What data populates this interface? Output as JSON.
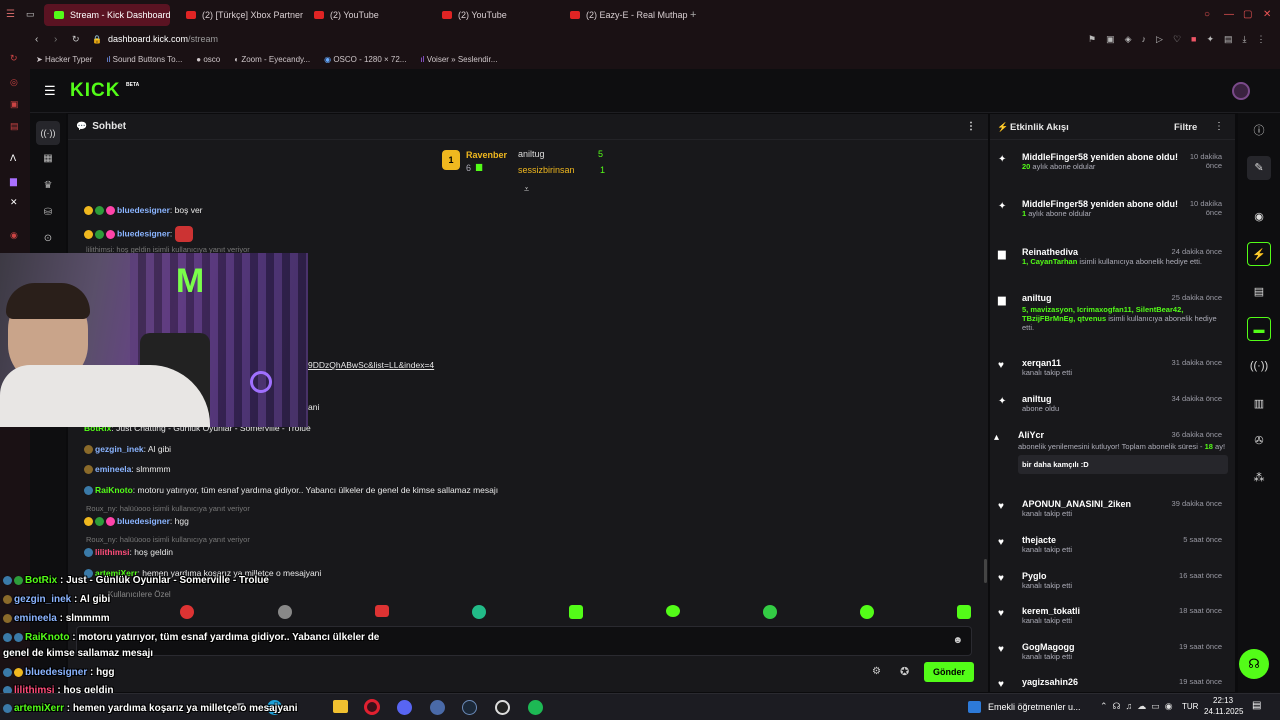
{
  "browser": {
    "tabs": [
      {
        "label": "Stream - Kick Dashboard",
        "active": true
      },
      {
        "label": "(2) [Türkçe] Xbox Partner"
      },
      {
        "label": "(2) YouTube"
      },
      {
        "label": "(2) YouTube"
      },
      {
        "label": "(2) Eazy-E - Real Muthaph"
      }
    ],
    "url_host": "dashboard.kick.com",
    "url_path": "/stream",
    "bookmarks": [
      "Hacker Typer",
      "Sound Buttons To...",
      "osco",
      "Zoom - Eyecandy...",
      "OSCO - 1280 × 72...",
      "Voiser » Seslendir..."
    ]
  },
  "app": {
    "logo": "KICK",
    "logo_badge": "BETA"
  },
  "chat": {
    "title": "Sohbet",
    "leaders": [
      {
        "rank": "1",
        "name": "Ravenber",
        "count": "6"
      },
      {
        "rank": "",
        "name": "aniltug",
        "count": "5"
      },
      {
        "rank": "",
        "name": "sessizbirinsan",
        "count": "1"
      }
    ],
    "messages": [
      {
        "user": "bluedesigner",
        "text": ": boş ver",
        "color": "#8ab4ff"
      },
      {
        "user": "bluedesigner",
        "text": ":",
        "color": "#8ab4ff"
      },
      {
        "reply": "lilithimsi: hoş geldin isimli kullanıcıya yanıt veriyor"
      },
      {
        "user": "BotRix",
        "text": ": Just Chatting - Günlük Oyunlar - Somerville - Trolue",
        "color": "#53fc18"
      },
      {
        "user": "gezgin_inek",
        "text": ": Al gibi",
        "color": "#8ab4ff"
      },
      {
        "user": "emineela",
        "text": ": slmmmm",
        "color": "#8ab4ff"
      },
      {
        "user": "RaiKnoto",
        "text": ": motoru yatırıyor, tüm esnaf yardıma gidiyor.. Yabancı ülkeler de genel de kimse sallamaz mesajı",
        "color": "#53fc18"
      },
      {
        "reply": "Roux_ny: halüüooo isimli kullanıcıya yanıt veriyor"
      },
      {
        "user": "bluedesigner",
        "text": ": hgg",
        "color": "#8ab4ff"
      },
      {
        "user": "lilithimsi",
        "text": ": hoş geldin",
        "color": "#ff4d7a"
      },
      {
        "reply": "Roux_ny: halüüooo isimli kullanıcıya yanıt veriyor"
      },
      {
        "user": "artemiXerr",
        "text": ": hemen yardıma koşarız ya milletçe o mesajyani",
        "color": "#53fc18"
      }
    ],
    "link_fragment": "9DDzQhABwSc&list=LL&index=4",
    "fragment_2": "ani",
    "emote_label": "Kullanıcılere Özel",
    "input_placeholder": "",
    "send_label": "Gönder"
  },
  "overlay": {
    "lines": [
      {
        "user": "BotRix",
        "text": " : Just      - Günlük Oyunlar - Somerville - Trolue"
      },
      {
        "user": "gezgin_inek",
        "text": " : Al gibi"
      },
      {
        "user": "emineela",
        "text": " : slmmmm"
      },
      {
        "user": "RaiKnoto",
        "text": " : motoru yatırıyor, tüm esnaf yardıma gidiyor.. Yabancı ülkeler de"
      },
      {
        "user": "",
        "text": "genel de kimse sallamaz mesajı"
      },
      {
        "user": "bluedesigner",
        "text": " : hgg"
      },
      {
        "user": "lilithimsi",
        "text": " : hoş geldin"
      },
      {
        "user": "artemiXerr",
        "text": " : hemen yardıma koşarız ya milletçe o mesajyani"
      }
    ]
  },
  "activity": {
    "title": "Etkinlik Akışı",
    "filter_label": "Filtre",
    "items": [
      {
        "title": "MiddleFinger58 yeniden abone oldu!",
        "highlight": "20",
        "sub": " aylık abone oldular",
        "time": "10 dakika önce"
      },
      {
        "title": "MiddleFinger58 yeniden abone oldu!",
        "highlight": "1",
        "sub": " aylık abone oldular",
        "time": "10 dakika önce"
      },
      {
        "title": "Reinathediva",
        "highlight": "1, CayanTarhan",
        "sub": " isimli kullanıcıya abonelik hediye etti.",
        "time": "24 dakika önce"
      },
      {
        "title": "aniltug",
        "highlight": "5, mavizasyon, Icrimaxogfan11, SilentBear42, TBzijFBrMnEg, qtvenus",
        "sub": " isimli kullanıcıya abonelik hediye etti.",
        "time": "25 dakika önce"
      },
      {
        "title": "xerqan11",
        "highlight": "",
        "sub": "kanalı takip etti",
        "time": "31 dakika önce"
      },
      {
        "title": "aniltug",
        "highlight": "",
        "sub": "abone oldu",
        "time": "34 dakika önce"
      },
      {
        "title": "AliYcr",
        "highlight": "18",
        "sub": "abonelik yenilemesini kutluyor! Toplam abonelik süresi - ",
        "sub2": " ay!",
        "note": "bir daha kamçılı :D",
        "time": "36 dakika önce"
      },
      {
        "title": "APONUN_ANASINI_2iken",
        "highlight": "",
        "sub": "kanalı takip etti",
        "time": "39 dakika önce"
      },
      {
        "title": "thejacte",
        "highlight": "",
        "sub": "kanalı takip etti",
        "time": "5 saat önce"
      },
      {
        "title": "Pyglo",
        "highlight": "",
        "sub": "kanalı takip etti",
        "time": "16 saat önce"
      },
      {
        "title": "kerem_tokatli",
        "highlight": "",
        "sub": "kanalı takip etti",
        "time": "18 saat önce"
      },
      {
        "title": "GogMagogg",
        "highlight": "",
        "sub": "kanalı takip etti",
        "time": "19 saat önce"
      },
      {
        "title": "yagizsahin26",
        "highlight": "",
        "sub": "",
        "time": "19 saat önce"
      }
    ]
  },
  "taskbar": {
    "news": "Emekli öğretmenler u...",
    "lang": "TUR",
    "time": "22:13",
    "date": "24.11.2025"
  },
  "colors": {
    "kick_green": "#53fc18",
    "panel": "#18181b",
    "bg": "#0b0b0d"
  }
}
